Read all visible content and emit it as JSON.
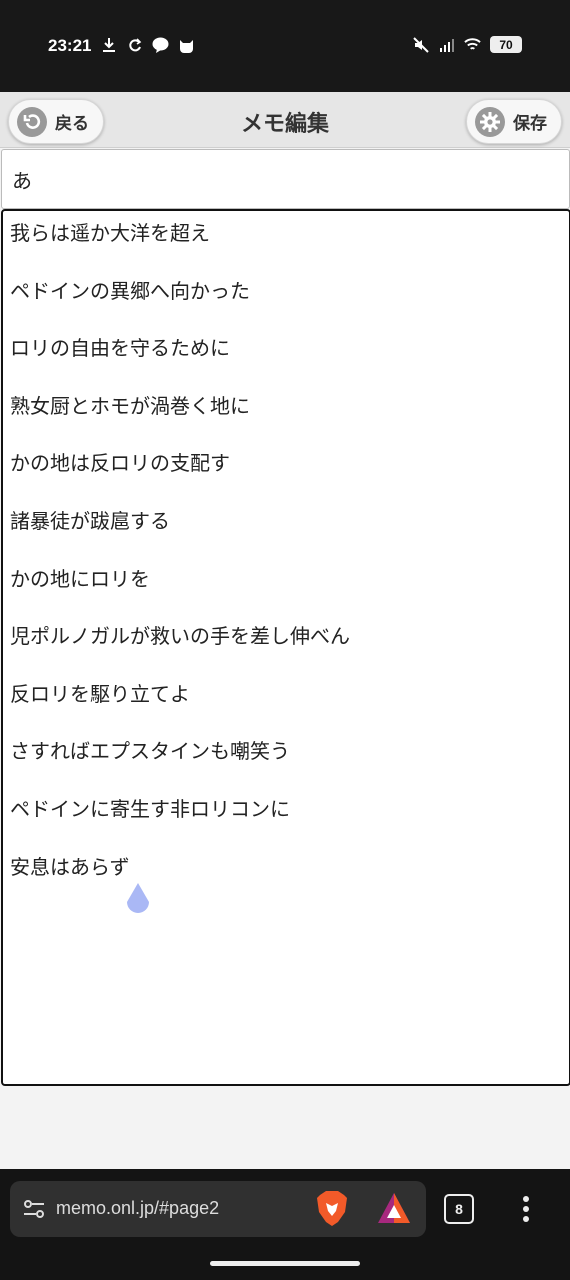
{
  "status_bar": {
    "time": "23:21",
    "battery": "70",
    "left_icons": [
      "download-icon",
      "sync-icon",
      "line-app-icon",
      "cat-app-icon"
    ],
    "right_icons": [
      "mute-icon",
      "signal-icon",
      "wifi-icon"
    ]
  },
  "header": {
    "title": "メモ編集",
    "back_label": "戻る",
    "save_label": "保存"
  },
  "memo": {
    "title_value": "あ",
    "lines": [
      "我らは遥か大洋を超え",
      "ペドインの異郷へ向かった",
      "ロリの自由を守るために",
      "熟女厨とホモが渦巻く地に",
      "かの地は反ロリの支配す",
      "諸暴徒が跋扈する",
      "かの地にロリを",
      "児ポルノガルが救いの手を差し伸べん",
      "反ロリを駆り立てよ",
      "さすればエプスタインも嘲笑う",
      "ペドインに寄生す非ロリコンに",
      "安息はあらず"
    ]
  },
  "browser": {
    "url": "memo.onl.jp/#page2",
    "tab_count": "8"
  },
  "colors": {
    "header_bg": "#e6e6e6",
    "icon_gray": "#999999",
    "cursor_handle": "#aab8f5"
  }
}
